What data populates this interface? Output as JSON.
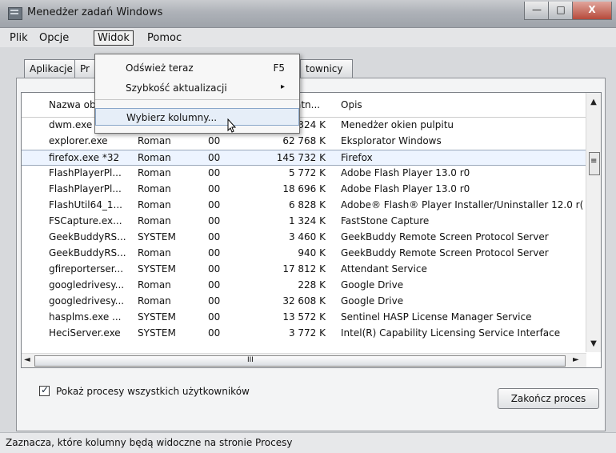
{
  "window": {
    "title": "Menedżer zadań Windows",
    "controls": {
      "minimize": "—",
      "maximize": "□",
      "close": "X"
    }
  },
  "menu": [
    {
      "label": "Plik"
    },
    {
      "label": "Opcje"
    },
    {
      "label": "Widok"
    },
    {
      "label": "Pomoc"
    }
  ],
  "dropdown": {
    "items": [
      {
        "label": "Odśwież teraz",
        "shortcut": "F5"
      },
      {
        "label": "Szybkość aktualizacji",
        "submenu_arrow": "▸"
      },
      {
        "label": "Wybierz kolumny..."
      }
    ]
  },
  "tabs": [
    {
      "label": "Aplikacje"
    },
    {
      "label": "Pr"
    },
    {
      "label": "townicy"
    }
  ],
  "table": {
    "headers": [
      "Nazwa ob",
      "atn...",
      "Opis"
    ],
    "rows": [
      {
        "name": "dwm.exe",
        "user": "",
        "session": "",
        "memory": "324 K",
        "desc": "Menedżer okien pulpitu"
      },
      {
        "name": "explorer.exe",
        "user": "Roman",
        "session": "00",
        "memory": "62 768 K",
        "desc": "Eksplorator Windows"
      },
      {
        "name": "firefox.exe *32",
        "user": "Roman",
        "session": "00",
        "memory": "145 732 K",
        "desc": "Firefox"
      },
      {
        "name": "FlashPlayerPl...",
        "user": "Roman",
        "session": "00",
        "memory": "5 772 K",
        "desc": "Adobe Flash Player 13.0 r0"
      },
      {
        "name": "FlashPlayerPl...",
        "user": "Roman",
        "session": "00",
        "memory": "18 696 K",
        "desc": "Adobe Flash Player 13.0 r0"
      },
      {
        "name": "FlashUtil64_1...",
        "user": "Roman",
        "session": "00",
        "memory": "6 828 K",
        "desc": "Adobe® Flash® Player Installer/Uninstaller 12.0 r("
      },
      {
        "name": "FSCapture.ex...",
        "user": "Roman",
        "session": "00",
        "memory": "1 324 K",
        "desc": "FastStone Capture"
      },
      {
        "name": "GeekBuddyRS...",
        "user": "SYSTEM",
        "session": "00",
        "memory": "3 460 K",
        "desc": "GeekBuddy Remote Screen Protocol Server"
      },
      {
        "name": "GeekBuddyRS...",
        "user": "Roman",
        "session": "00",
        "memory": "940 K",
        "desc": "GeekBuddy Remote Screen Protocol Server"
      },
      {
        "name": "gfireporterser...",
        "user": "SYSTEM",
        "session": "00",
        "memory": "17 812 K",
        "desc": "Attendant Service"
      },
      {
        "name": "googledrivesy...",
        "user": "Roman",
        "session": "00",
        "memory": "228 K",
        "desc": "Google Drive"
      },
      {
        "name": "googledrivesy...",
        "user": "Roman",
        "session": "00",
        "memory": "32 608 K",
        "desc": "Google Drive"
      },
      {
        "name": "hasplms.exe ...",
        "user": "SYSTEM",
        "session": "00",
        "memory": "13 572 K",
        "desc": "Sentinel HASP License Manager Service"
      },
      {
        "name": "HeciServer.exe",
        "user": "SYSTEM",
        "session": "00",
        "memory": "3 772 K",
        "desc": "Intel(R) Capability Licensing Service Interface"
      }
    ]
  },
  "scroll": {
    "up": "▲",
    "down": "▼",
    "left": "◄",
    "right": "►",
    "grip": "≡",
    "hgrip": "III"
  },
  "controls": {
    "show_all_label": "Pokaż procesy wszystkich użytkowników",
    "show_all_checked": true,
    "end_process_label": "Zakończ proces"
  },
  "status": {
    "text": "Zaznacza, które kolumny będą widoczne na stronie Procesy"
  }
}
